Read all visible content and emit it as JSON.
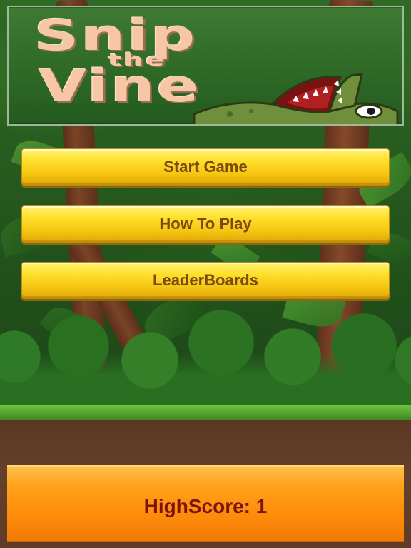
{
  "title": {
    "line1": "Snip",
    "line2": "the",
    "line3": "Vine"
  },
  "menu": {
    "start_label": "Start Game",
    "howto_label": "How To Play",
    "leaderboards_label": "LeaderBoards"
  },
  "highscore": {
    "text": "HighScore: 1"
  },
  "colors": {
    "button_yellow": "#ffe12e",
    "button_text": "#7a4a0e",
    "title_text": "#f5c7a4",
    "highscore_orange": "#ff8e0c",
    "highscore_text": "#7a1410"
  },
  "icons": {
    "mascot": "crocodile-icon"
  }
}
